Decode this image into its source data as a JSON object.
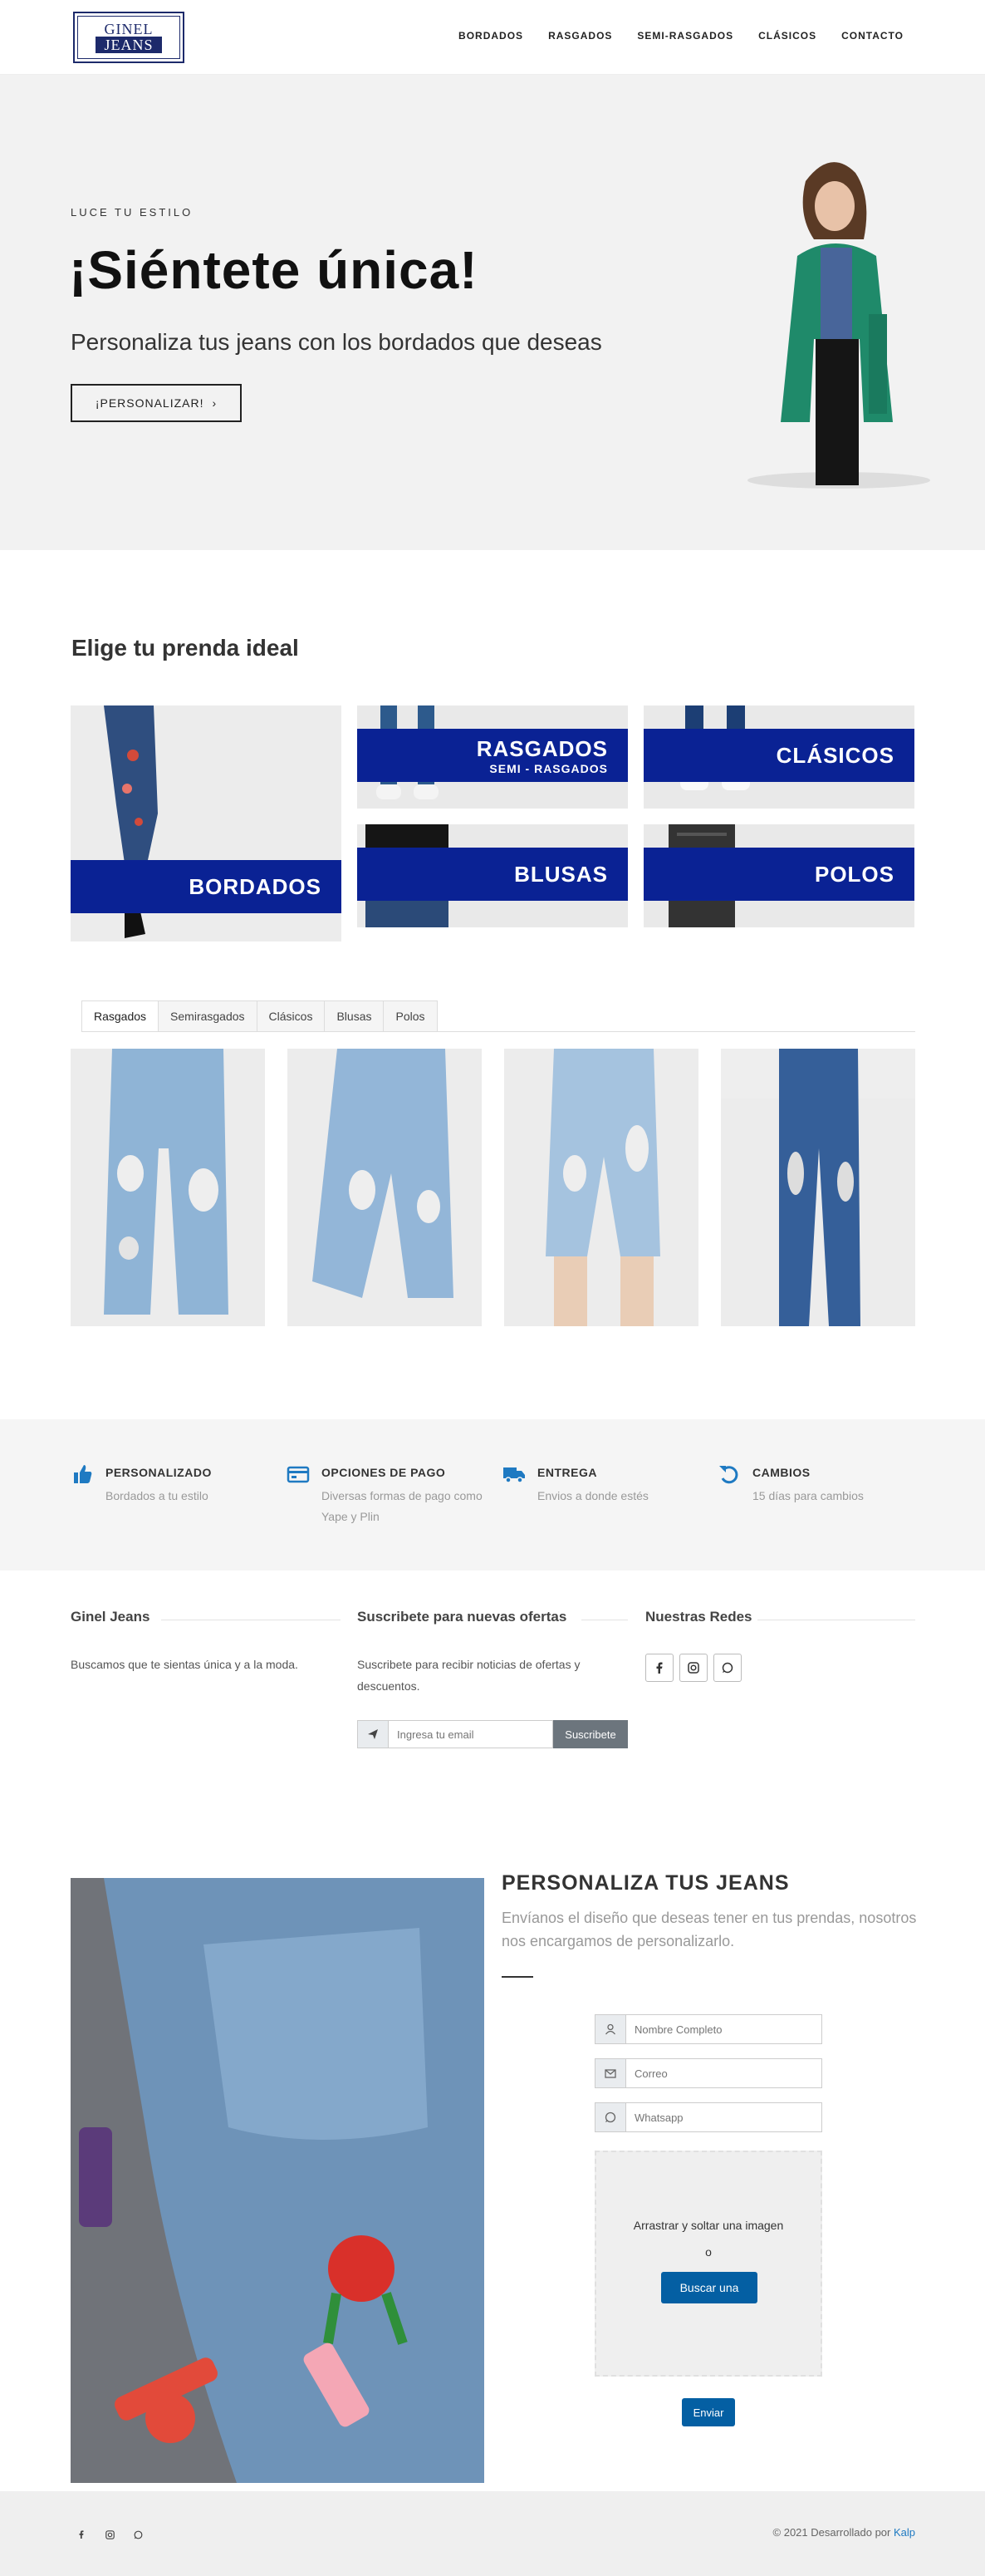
{
  "header": {
    "logo_line1": "GINEL",
    "logo_line2": "JEANS",
    "nav": [
      "BORDADOS",
      "RASGADOS",
      "SEMI-RASGADOS",
      "CLÁSICOS",
      "CONTACTO"
    ]
  },
  "hero": {
    "kicker": "LUCE TU ESTILO",
    "title": "¡Siéntete única!",
    "subtitle": "Personaliza tus jeans con los bordados que deseas",
    "button": "¡PERSONALIZAR!"
  },
  "categories": {
    "heading": "Elige tu prenda ideal",
    "items": [
      {
        "title": "BORDADOS",
        "subtitle": ""
      },
      {
        "title": "RASGADOS",
        "subtitle": "SEMI - RASGADOS"
      },
      {
        "title": "CLÁSICOS",
        "subtitle": ""
      },
      {
        "title": "BLUSAS",
        "subtitle": ""
      },
      {
        "title": "POLOS",
        "subtitle": ""
      }
    ]
  },
  "tabs": [
    "Rasgados",
    "Semirasgados",
    "Clásicos",
    "Blusas",
    "Polos"
  ],
  "active_tab": "Rasgados",
  "features": [
    {
      "title": "PERSONALIZADO",
      "desc": "Bordados a tu estilo",
      "icon": "thumbs-up-icon"
    },
    {
      "title": "OPCIONES DE PAGO",
      "desc": "Diversas formas de pago como Yape y Plin",
      "icon": "credit-card-icon"
    },
    {
      "title": "ENTREGA",
      "desc": "Envios a donde estés",
      "icon": "truck-icon"
    },
    {
      "title": "CAMBIOS",
      "desc": "15 días para cambios",
      "icon": "undo-icon"
    }
  ],
  "footer": {
    "about_title": "Ginel Jeans",
    "about_text": "Buscamos que te sientas única y a la moda.",
    "newsletter_title": "Suscribete para nuevas ofertas",
    "newsletter_text": "Suscribete para recibir noticias de ofertas y descuentos.",
    "newsletter_placeholder": "Ingresa tu email",
    "newsletter_button": "Suscribete",
    "social_title": "Nuestras Redes"
  },
  "personalize": {
    "title": "PERSONALIZA TUS JEANS",
    "subtitle": "Envíanos el diseño que deseas tener en tus prendas, nosotros nos encargamos de personalizarlo.",
    "name_placeholder": "Nombre Completo",
    "email_placeholder": "Correo",
    "whatsapp_placeholder": "Whatsapp",
    "drop_text": "Arrastrar y soltar una imagen",
    "or_text": "o",
    "browse_button": "Buscar una",
    "send_button": "Enviar"
  },
  "bottom": {
    "copyright": "© 2021 Desarrollado por ",
    "brand": "Kalp"
  },
  "colors": {
    "accent_blue": "#0a2294",
    "button_blue": "#045fa3",
    "icon_blue": "#1f7ac2"
  }
}
